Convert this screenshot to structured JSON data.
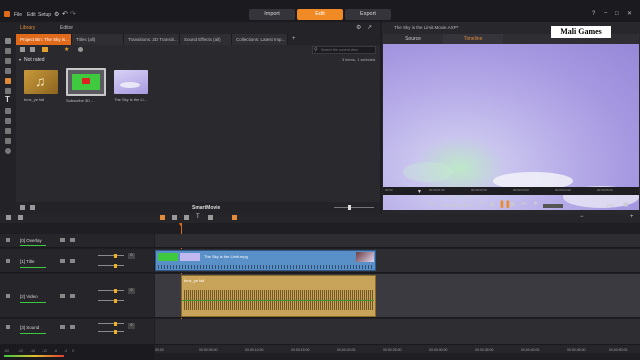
{
  "app": {
    "menu": [
      "File",
      "Edit",
      "Setup"
    ],
    "modes": [
      {
        "label": "Import",
        "active": false
      },
      {
        "label": "Edit",
        "active": true
      },
      {
        "label": "Export",
        "active": false
      }
    ]
  },
  "library": {
    "title": "Library",
    "editor_label": "Editor",
    "tabs": [
      {
        "label": "Project Bin: The Sky is...",
        "active": true
      },
      {
        "label": "Titles (all)",
        "active": false
      },
      {
        "label": "Transitions: 2D Transiti...",
        "active": false
      },
      {
        "label": "Sound Effects (all)",
        "active": false
      },
      {
        "label": "Collections: Latest Imp...",
        "active": false
      }
    ],
    "search_placeholder": "Search the current view",
    "group_label": "Not rated",
    "items_count": "3 items, 1 selected",
    "items": [
      {
        "label": "bmx_ye fail",
        "kind": "audio"
      },
      {
        "label": "Subscribe 3D ...",
        "kind": "video-green"
      },
      {
        "label": "The Sky is the Li...",
        "kind": "video-sky"
      }
    ],
    "bottom_label": "SmartMovie"
  },
  "player": {
    "file_title": "The Sky is the Limit.Movie.AXP*",
    "tabs": [
      {
        "label": "Source",
        "active": false
      },
      {
        "label": "Timeline",
        "active": true
      }
    ],
    "scrub_labels": [
      "00:00",
      "00:00:01:00",
      "00:00:02:00",
      "00:00:03:00",
      "00:00:04:00",
      "00:00:05:00"
    ],
    "pip_label": "PiP",
    "watermark": "Mali Games"
  },
  "timeline": {
    "ruler": [
      "00:00",
      "00:00:05:00",
      "00:00:10:00",
      "00:00:15:00",
      "00:00:20:00",
      "00:00:25:00",
      "00:00:30:00",
      "00:00:35:00",
      "00:00:40:00",
      "00:00:45:00",
      "00:00:50:00"
    ],
    "tracks": [
      {
        "name": "[0] Overlay",
        "value": "0"
      },
      {
        "name": "[1] Title",
        "value": "0"
      },
      {
        "name": "[2] Video",
        "value": "0"
      },
      {
        "name": "[3] Sound",
        "value": "0"
      }
    ],
    "clip_title": "The Sky is the Limit.mpg",
    "clip_video": "bmx_ye fail",
    "footer": [
      "-60",
      "-22",
      "-16",
      "-12",
      "-6",
      "-3",
      "0"
    ]
  },
  "colors": {
    "accent": "#f08a24",
    "clip_blue": "#5a90c8",
    "clip_gold": "#c8a45a",
    "green_level": "#3cc840"
  }
}
